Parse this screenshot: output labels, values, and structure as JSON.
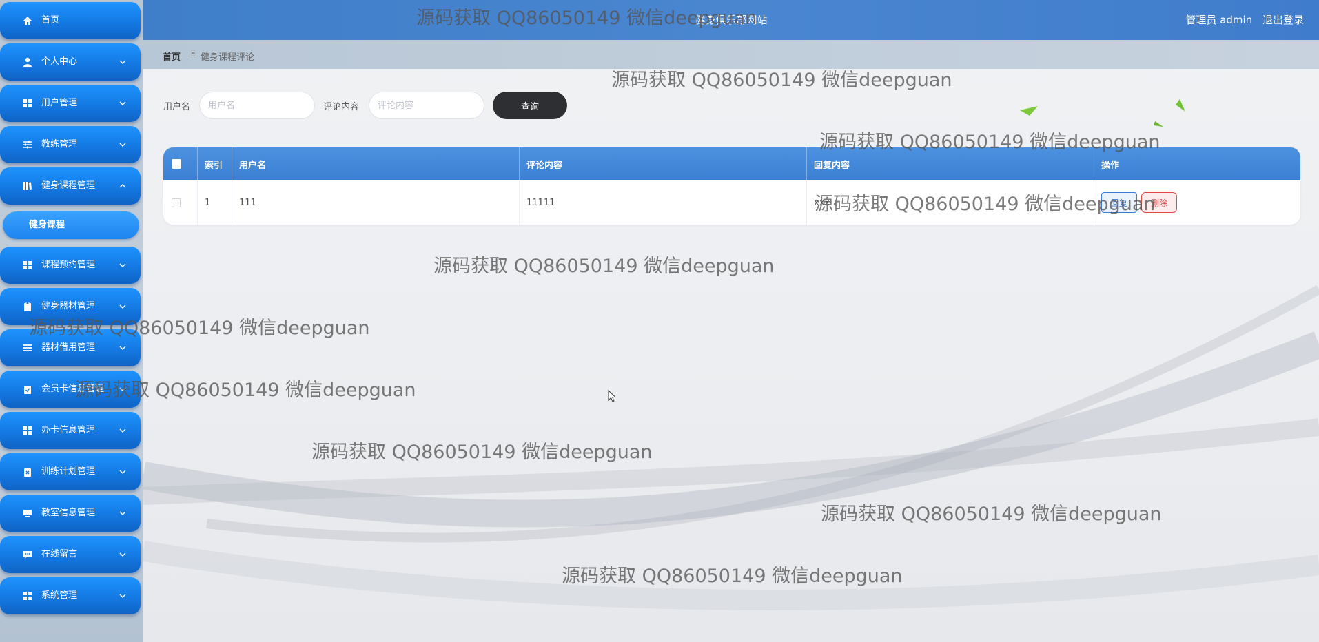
{
  "header": {
    "site_title": "健身俱乐部网站",
    "user_label": "管理员 admin",
    "logout_label": "退出登录"
  },
  "sidebar": {
    "items": [
      {
        "label": "首页",
        "icon": "home-icon"
      },
      {
        "label": "个人中心",
        "icon": "person-icon"
      },
      {
        "label": "用户管理",
        "icon": "grid-icon"
      },
      {
        "label": "教练管理",
        "icon": "sliders-icon"
      },
      {
        "label": "健身课程管理",
        "icon": "book-icon"
      },
      {
        "label": "课程预约管理",
        "icon": "grid-icon"
      },
      {
        "label": "健身器材管理",
        "icon": "clipboard-icon"
      },
      {
        "label": "器材借用管理",
        "icon": "list-icon"
      },
      {
        "label": "会员卡信息管理",
        "icon": "clipboard-check-icon"
      },
      {
        "label": "办卡信息管理",
        "icon": "grid-icon"
      },
      {
        "label": "训练计划管理",
        "icon": "clipboard-x-icon"
      },
      {
        "label": "教室信息管理",
        "icon": "monitor-icon"
      },
      {
        "label": "在线留言",
        "icon": "message-icon"
      },
      {
        "label": "系统管理",
        "icon": "grid-icon"
      }
    ],
    "sub_item": "健身课程"
  },
  "breadcrumb": {
    "home": "首页",
    "separator": "Ξ",
    "current": "健身课程评论"
  },
  "search": {
    "username_label": "用户名",
    "username_placeholder": "用户名",
    "comment_label": "评论内容",
    "comment_placeholder": "评论内容",
    "query_label": "查询"
  },
  "table": {
    "headers": {
      "index": "索引",
      "username": "用户名",
      "comment": "评论内容",
      "reply": "回复内容",
      "actions": "操作"
    },
    "rows": [
      {
        "index": "1",
        "username": "111",
        "comment": "11111",
        "reply": "xxx",
        "edit": "回复",
        "delete": "删除"
      }
    ]
  },
  "watermark": "源码获取 QQ86050149 微信deepguan"
}
